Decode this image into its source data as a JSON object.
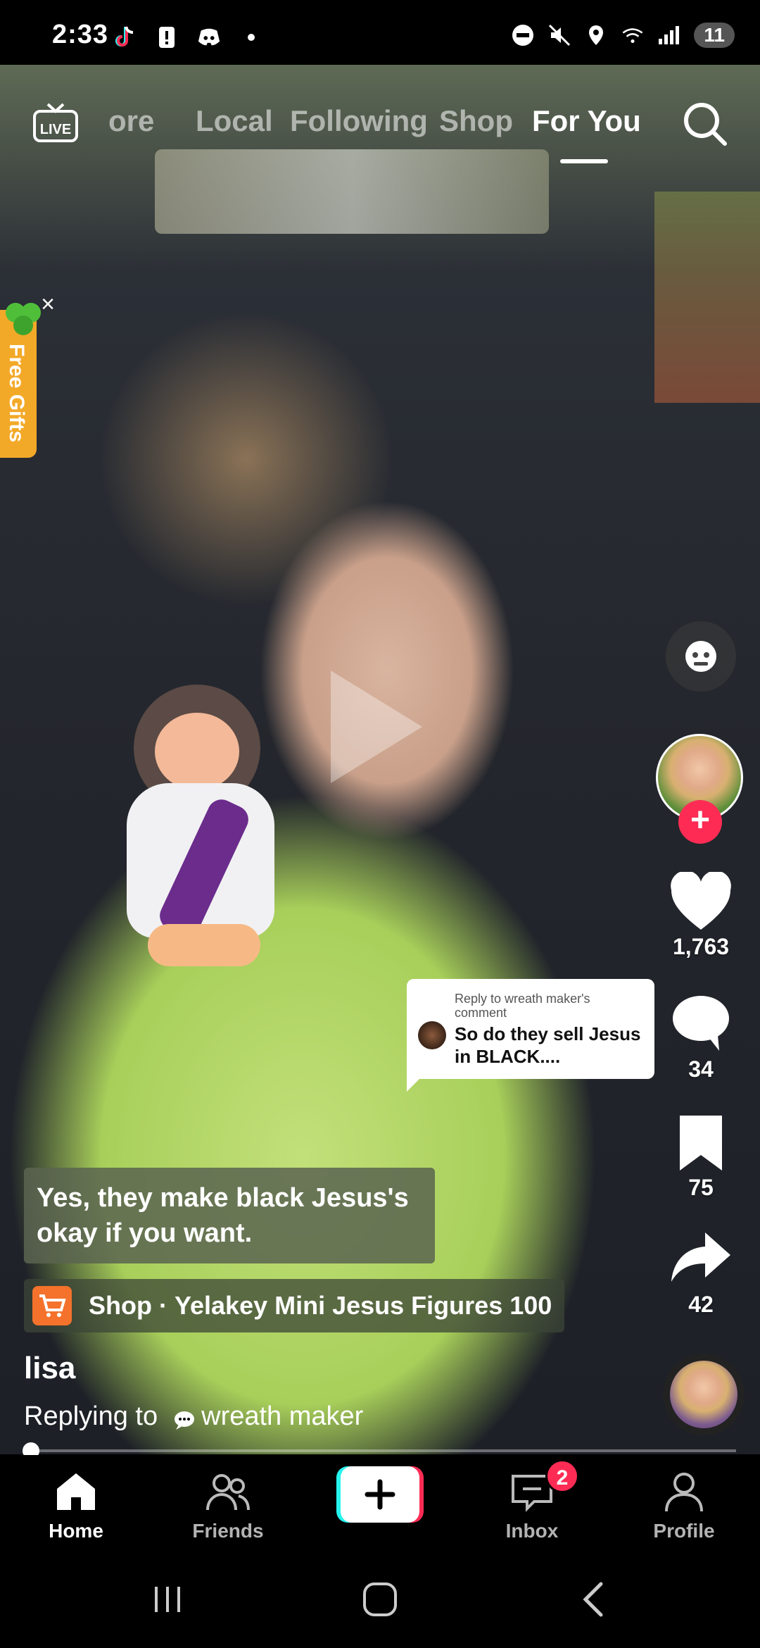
{
  "status_bar": {
    "time": "2:33",
    "battery": "11",
    "wifi_label": "5"
  },
  "top_nav": {
    "tabs": [
      {
        "label": "ore"
      },
      {
        "label": "Local"
      },
      {
        "label": "Following"
      },
      {
        "label": "Shop"
      },
      {
        "label": "For You"
      }
    ],
    "live_label": "LIVE",
    "active_tab": "For You"
  },
  "free_gifts": {
    "label": "Free Gifts",
    "close": "×"
  },
  "reply_bubble": {
    "header": "Reply to wreath maker's comment",
    "text": "So do they sell Jesus in BLACK...."
  },
  "caption": {
    "text": "Yes, they make black Jesus's okay if you want."
  },
  "shop": {
    "label": "Shop",
    "separator": "·",
    "product": "Yelakey Mini Jesus Figures 100"
  },
  "post": {
    "username": "lisa",
    "replying_prefix": "Replying to",
    "replying_target": "wreath maker"
  },
  "rail": {
    "likes": "1,763",
    "comments": "34",
    "saves": "75",
    "shares": "42",
    "follow": "+"
  },
  "progress": {
    "fraction": 0.01
  },
  "bottom_nav": {
    "items": [
      {
        "label": "Home"
      },
      {
        "label": "Friends"
      },
      {
        "label": "Inbox"
      },
      {
        "label": "Profile"
      }
    ],
    "create_symbol": "+",
    "inbox_badge": "2"
  },
  "colors": {
    "accent_red": "#fe2c55",
    "shop_orange": "#f4722b",
    "gifts_yellow": "#f3a928",
    "create_cyan": "#25f4ee"
  }
}
